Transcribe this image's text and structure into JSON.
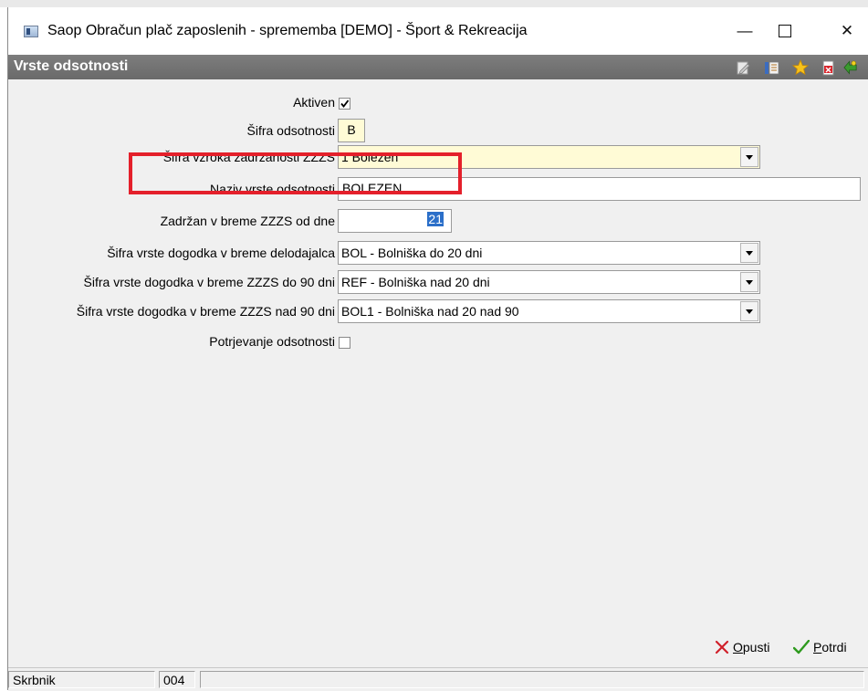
{
  "window": {
    "title": "Saop Obračun plač zaposlenih - sprememba [DEMO] - Šport & Rekreacija",
    "minimize_glyph": "—",
    "close_glyph": "✕"
  },
  "header": {
    "title": "Vrste odsotnosti",
    "toolbar_icons": [
      "edit-note-icon",
      "list-view-icon",
      "favorite-star-icon",
      "pdf-export-icon",
      "exit-door-icon"
    ]
  },
  "form": {
    "aktiven": {
      "label": "Aktiven",
      "checked": true
    },
    "sifra_odsotnosti": {
      "label": "Šifra odsotnosti",
      "value": "B"
    },
    "sifra_vzroka": {
      "label": "Šifra vzroka zadržanosti ZZZS",
      "value": "1 Bolezen"
    },
    "naziv": {
      "label": "Naziv vrste odsotnosti",
      "value": "BOLEZEN"
    },
    "zadrzan": {
      "label": "Zadržan v breme ZZZS od dne",
      "value": "21"
    },
    "dogodek_delodajalca": {
      "label": "Šifra vrste dogodka v breme delodajalca",
      "value": "BOL - Bolniška do 20 dni"
    },
    "dogodek_do_90": {
      "label": "Šifra vrste dogodka v breme ZZZS do 90 dni",
      "value": "REF - Bolniška nad 20 dni"
    },
    "dogodek_nad_90": {
      "label": "Šifra vrste dogodka v breme ZZZS nad 90 dni",
      "value": "BOL1 - Bolniška nad 20 nad 90"
    },
    "potrjevanje": {
      "label": "Potrjevanje odsotnosti",
      "checked": false
    }
  },
  "actions": {
    "cancel_first": "O",
    "cancel_rest": "pusti",
    "confirm_first": "P",
    "confirm_rest": "otrdi"
  },
  "status": {
    "user": "Skrbnik",
    "code": "004",
    "extra": ""
  },
  "colors": {
    "header_bg": "#707070",
    "highlight": "#e4202b",
    "field_yellow": "#fffbd6",
    "selection": "#2b6fc9"
  }
}
